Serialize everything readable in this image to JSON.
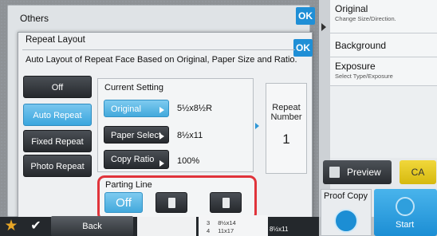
{
  "others": {
    "title": "Others",
    "ok": "OK"
  },
  "dialog": {
    "title": "Repeat Layout",
    "ok": "OK",
    "description": "Auto Layout of Repeat Face Based on Original, Paper Size and Ratio."
  },
  "modes": [
    {
      "label": "Off",
      "selected": false
    },
    {
      "label": "Auto Repeat",
      "selected": true
    },
    {
      "label": "Fixed Repeat",
      "selected": false
    },
    {
      "label": "Photo Repeat",
      "selected": false
    }
  ],
  "current_setting": {
    "title": "Current Setting",
    "original_label": "Original",
    "original_value": "5½x8½R",
    "paper_select_label": "Paper Select",
    "paper_select_value": "8½x11",
    "copy_ratio_label": "Copy Ratio",
    "copy_ratio_value": "100%"
  },
  "repeat_number": {
    "label_line1": "Repeat",
    "label_line2": "Number",
    "value": "1"
  },
  "parting_line": {
    "title": "Parting Line",
    "off_label": "Off",
    "selected": "Off"
  },
  "right_panel": {
    "original": {
      "title": "Original",
      "subtitle": "Change Size/Direction."
    },
    "background_adjustment": "Background Adjustment",
    "exposure": {
      "title": "Exposure",
      "subtitle": "Select Type/Exposure"
    }
  },
  "actions": {
    "preview": "Preview",
    "ca": "CA",
    "proof_copy": "Proof Copy",
    "start": "Start"
  },
  "bottom": {
    "back": "Back",
    "paper_rows": [
      {
        "tray": "3",
        "size": "8½x14"
      },
      {
        "tray": "4",
        "size": "11x17"
      }
    ],
    "selected_paper": "8½x11"
  },
  "colors": {
    "accent": "#43a9dc",
    "highlight": "#e0343b",
    "ca": "#e3c624"
  }
}
